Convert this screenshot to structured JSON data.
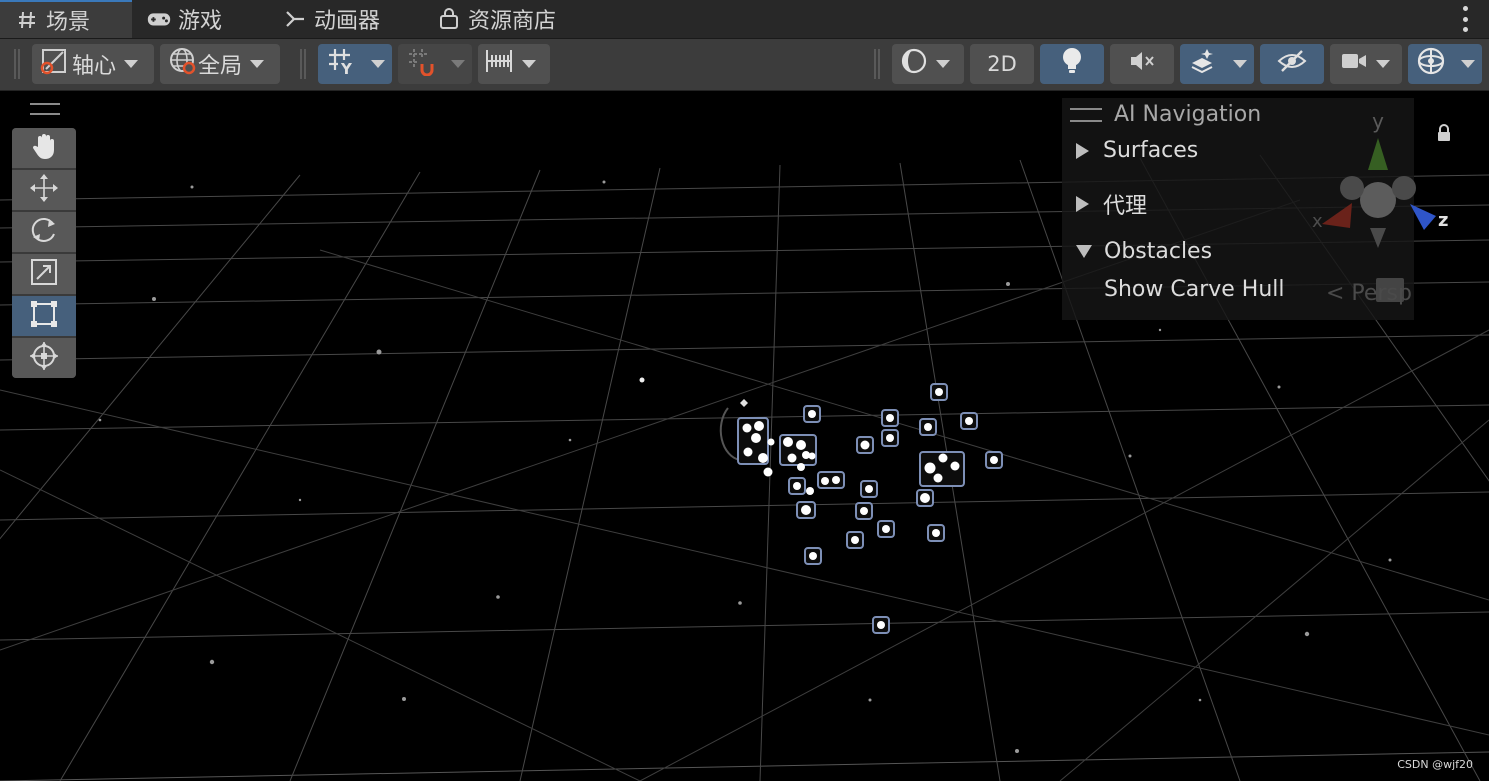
{
  "tabs": [
    {
      "label": "场景",
      "icon": "hash-icon",
      "active": true
    },
    {
      "label": "游戏",
      "icon": "gamepad-icon",
      "active": false
    },
    {
      "label": "动画器",
      "icon": "animator-icon",
      "active": false
    },
    {
      "label": "资源商店",
      "icon": "shopping-bag-icon",
      "active": false
    }
  ],
  "toolbar": {
    "pivot_label": "轴心",
    "global_label": "全局",
    "mode_2d_label": "2D"
  },
  "tools": [
    "hand-tool",
    "move-tool",
    "rotate-tool",
    "scale-tool",
    "rect-tool",
    "transform-tool"
  ],
  "overlay": {
    "title": "AI Navigation",
    "items": [
      {
        "label": "Surfaces",
        "expanded": false
      },
      {
        "label": "代理",
        "expanded": false
      },
      {
        "label": "Obstacles",
        "expanded": true
      }
    ],
    "option_label": "Show Carve Hull"
  },
  "gizmo": {
    "y": "y",
    "x": "x",
    "z": "z",
    "projection": "< Persp"
  },
  "watermark": "CSDN @wjf20",
  "colors": {
    "accent": "#46607c",
    "tab_indicator": "#3a79bb",
    "axis_y": "#5fa83a",
    "axis_x": "#c83a2a",
    "axis_z": "#3b63d6"
  }
}
